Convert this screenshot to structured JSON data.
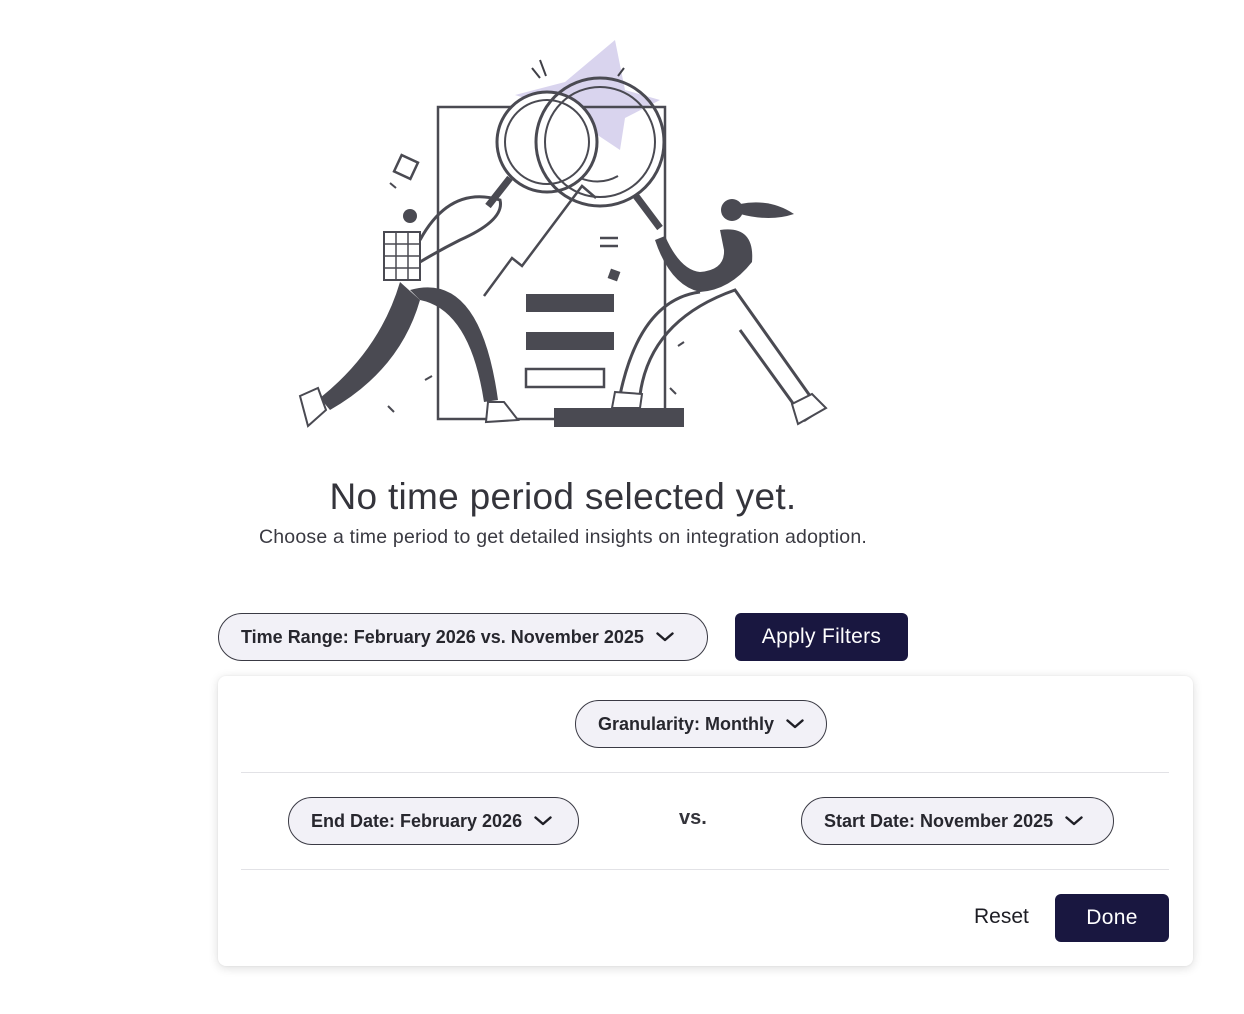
{
  "empty_state": {
    "title": "No time period selected yet.",
    "subtitle": "Choose a time period to get detailed insights on integration adoption."
  },
  "filters": {
    "time_range_label": "Time Range: February 2026 vs. November 2025",
    "apply_label": "Apply Filters"
  },
  "panel": {
    "granularity_label": "Granularity: Monthly",
    "end_date_label": "End Date: February 2026",
    "vs_label": "vs.",
    "start_date_label": "Start Date: November 2025",
    "reset_label": "Reset",
    "done_label": "Done"
  },
  "icons": {
    "dropdown": "chevron-down-icon",
    "illustration": "magnifying-glass-search-illustration"
  },
  "colors": {
    "primary": "#191740",
    "pill_background": "#f2f1f7",
    "accent_lavender": "#d9d4ee",
    "ink": "#3f3f46"
  }
}
